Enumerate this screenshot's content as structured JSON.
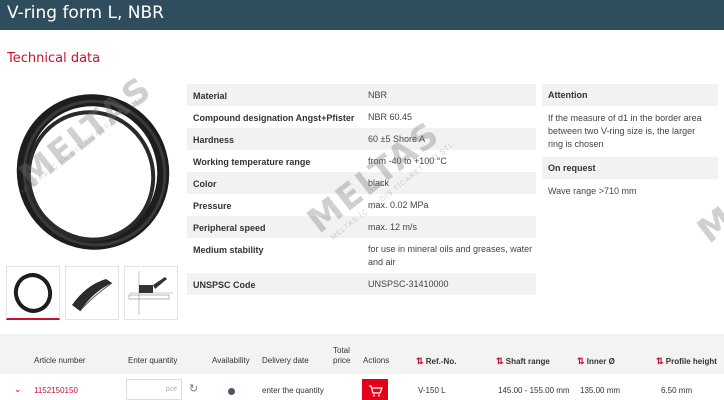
{
  "header": {
    "title": "V-ring form L, NBR"
  },
  "section": {
    "title": "Technical data"
  },
  "specs": [
    {
      "key": "Material",
      "value": "NBR"
    },
    {
      "key": "Compound designation Angst+Pfister",
      "value": "NBR 60.45"
    },
    {
      "key": "Hardness",
      "value": "60 ±5 Shore A"
    },
    {
      "key": "Working temperature range",
      "value": "from -40 to +100 °C"
    },
    {
      "key": "Color",
      "value": "black"
    },
    {
      "key": "Pressure",
      "value": "max. 0.02 MPa"
    },
    {
      "key": "Peripheral speed",
      "value": "max. 12 m/s"
    },
    {
      "key": "Medium stability",
      "value": "for use in mineral oils and greases, water and air"
    },
    {
      "key": "UNSPSC Code",
      "value": "UNSPSC-31410000"
    }
  ],
  "side": {
    "attention_title": "Attention",
    "attention_text": "If the measure of d1 in the border area between two V-ring size is, the larger ring is chosen",
    "request_title": "On request",
    "request_text": "Wave range >710 mm"
  },
  "watermark": {
    "text": "MELTAS",
    "sub": "MELTAS İÇ VE DIŞ TİCARET LTD.ŞTİ."
  },
  "grid": {
    "headers": {
      "article": "Article number",
      "qty": "Enter quantity",
      "availability": "Availability",
      "delivery": "Delivery date",
      "total_1": "Total",
      "total_2": "price",
      "actions": "Actions",
      "ref": "Ref.-No.",
      "shaft": "Shaft range",
      "inner": "Inner Ø",
      "profile": "Profile height"
    },
    "row": {
      "article": "1152150150",
      "qty_unit": "pce",
      "delivery": "enter the quantity",
      "ref": "V-150 L",
      "shaft": "145.00 - 155.00 mm",
      "inner": "135.00 mm",
      "profile": "6.50 mm"
    }
  },
  "colors": {
    "accent": "#c8102e",
    "header_bg": "#2f4d5d",
    "cart": "#e2001a"
  }
}
